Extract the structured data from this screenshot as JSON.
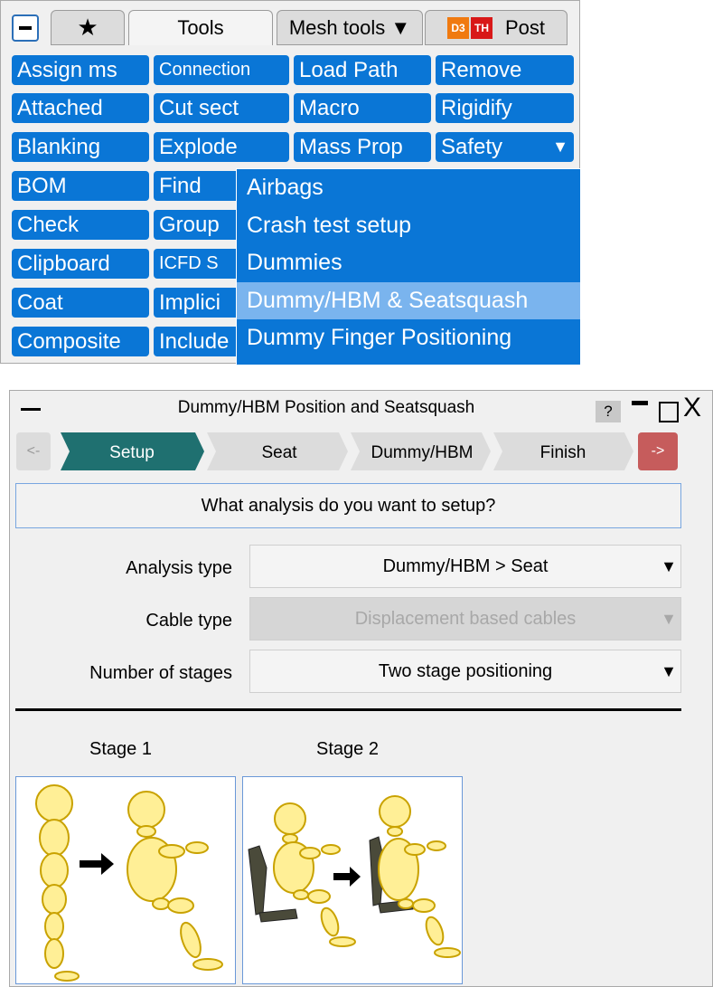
{
  "tool_panel": {
    "tabs": {
      "favourites": "★",
      "tools": "Tools",
      "mesh_tools": "Mesh tools ▼",
      "post_icons": [
        "D3",
        "TH"
      ],
      "post": "Post"
    },
    "buttons": {
      "col1": [
        "Assign ms",
        "Attached",
        "Blanking",
        "BOM",
        "Check",
        "Clipboard",
        "Coat",
        "Composite"
      ],
      "col2": [
        "Connection",
        "Cut sect",
        "Explode",
        "Find",
        "Group",
        "ICFD S",
        "Implici",
        "Include"
      ],
      "col3": [
        "Load Path",
        "Macro",
        "Mass Prop"
      ],
      "col4": [
        "Remove",
        "Rigidify",
        "Safety"
      ]
    },
    "safety_caret": "▼",
    "safety_menu": [
      "Airbags",
      "Crash test setup",
      "Dummies",
      "Dummy/HBM & Seatsquash",
      "Dummy Finger Positioning"
    ],
    "colors": {
      "button_blue": "#0a76d6",
      "menu_highlight": "#7ab4ee"
    }
  },
  "dialog": {
    "title": "Dummy/HBM Position and Seatsquash",
    "help": "?",
    "close": "X",
    "nav_back": "<-",
    "nav_next": "->",
    "steps": [
      "Setup",
      "Seat",
      "Dummy/HBM",
      "Finish"
    ],
    "active_step": "Setup",
    "question": "What analysis do you want to setup?",
    "fields": {
      "analysis_type": {
        "label": "Analysis type",
        "value": "Dummy/HBM > Seat"
      },
      "cable_type": {
        "label": "Cable type",
        "value": "Displacement based cables",
        "disabled": true
      },
      "stages": {
        "label": "Number of stages",
        "value": "Two stage positioning"
      }
    },
    "dropdown_arrow": "▼",
    "stage_labels": [
      "Stage 1",
      "Stage 2"
    ],
    "colors": {
      "active_step": "#1f7070",
      "inactive_step": "#dcdcdc",
      "next_button": "#c65c5c"
    }
  }
}
